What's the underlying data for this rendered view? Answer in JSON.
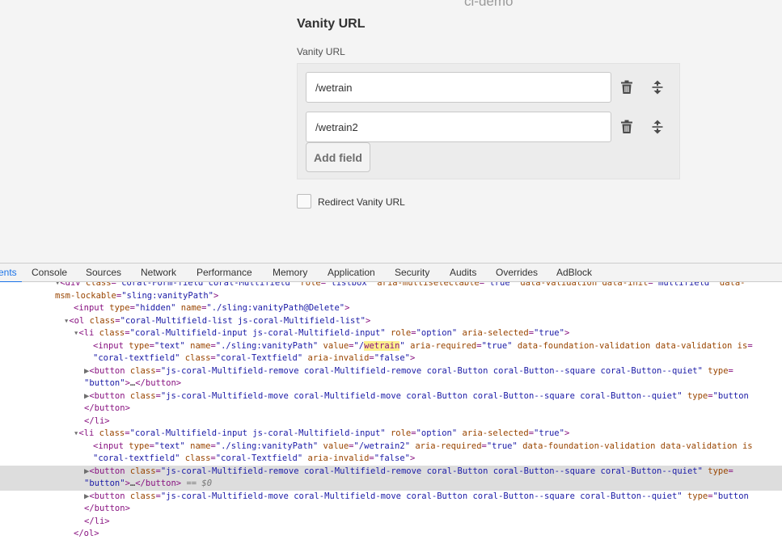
{
  "app": {
    "header_text": "ci-demo",
    "section_title": "Vanity URL",
    "field_label": "Vanity URL",
    "fields": [
      {
        "value": "/wetrain"
      },
      {
        "value": "/wetrain2"
      }
    ],
    "add_field_label": "Add field",
    "redirect_label": "Redirect Vanity URL"
  },
  "devtools": {
    "tabs": [
      {
        "label": "ents",
        "active": true
      },
      {
        "label": "Console"
      },
      {
        "label": "Sources"
      },
      {
        "label": "Network"
      },
      {
        "label": "Performance"
      },
      {
        "label": "Memory"
      },
      {
        "label": "Application"
      },
      {
        "label": "Security"
      },
      {
        "label": "Audits"
      },
      {
        "label": "Overrides"
      },
      {
        "label": "AdBlock"
      }
    ],
    "lines": [
      {
        "indent": 68,
        "parts": [
          [
            "tri",
            "▾"
          ],
          [
            "tag",
            "<div "
          ],
          [
            "attr-name",
            "class"
          ],
          [
            "eq",
            "="
          ],
          [
            "attr-val",
            "\"coral-Form-field coral-Multifield\" "
          ],
          [
            "attr-name",
            "role"
          ],
          [
            "eq",
            "="
          ],
          [
            "attr-val",
            "\"listbox\" "
          ],
          [
            "attr-name",
            "aria-multiselectable"
          ],
          [
            "eq",
            "="
          ],
          [
            "attr-val",
            "\"true\" "
          ],
          [
            "attr-name",
            "data-validation data-init"
          ],
          [
            "eq",
            "="
          ],
          [
            "attr-val",
            "\"multifield\" "
          ],
          [
            "attr-name",
            "data-"
          ]
        ]
      },
      {
        "indent": 68,
        "parts": [
          [
            "attr-name",
            "msm-lockable"
          ],
          [
            "eq",
            "="
          ],
          [
            "attr-val",
            "\"sling:vanityPath\""
          ],
          [
            "tag",
            ">"
          ]
        ]
      },
      {
        "indent": 91,
        "parts": [
          [
            "tag",
            "<input "
          ],
          [
            "attr-name",
            "type"
          ],
          [
            "eq",
            "="
          ],
          [
            "attr-val",
            "\"hidden\" "
          ],
          [
            "attr-name",
            "name"
          ],
          [
            "eq",
            "="
          ],
          [
            "attr-val",
            "\"./sling:vanityPath@Delete\""
          ],
          [
            "tag",
            ">"
          ]
        ]
      },
      {
        "indent": 79,
        "parts": [
          [
            "tri",
            "▾"
          ],
          [
            "tag",
            "<ol "
          ],
          [
            "attr-name",
            "class"
          ],
          [
            "eq",
            "="
          ],
          [
            "attr-val",
            "\"coral-Multifield-list js-coral-Multifield-list\""
          ],
          [
            "tag",
            ">"
          ]
        ]
      },
      {
        "indent": 91,
        "parts": [
          [
            "tri",
            "▾"
          ],
          [
            "tag",
            "<li "
          ],
          [
            "attr-name",
            "class"
          ],
          [
            "eq",
            "="
          ],
          [
            "attr-val",
            "\"coral-Multifield-input js-coral-Multifield-input\" "
          ],
          [
            "attr-name",
            "role"
          ],
          [
            "eq",
            "="
          ],
          [
            "attr-val",
            "\"option\" "
          ],
          [
            "attr-name",
            "aria-selected"
          ],
          [
            "eq",
            "="
          ],
          [
            "attr-val",
            "\"true\""
          ],
          [
            "tag",
            ">"
          ]
        ]
      },
      {
        "indent": 115,
        "parts": [
          [
            "tag",
            "<input "
          ],
          [
            "attr-name",
            "type"
          ],
          [
            "eq",
            "="
          ],
          [
            "attr-val",
            "\"text\" "
          ],
          [
            "attr-name",
            "name"
          ],
          [
            "eq",
            "="
          ],
          [
            "attr-val",
            "\"./sling:vanityPath\" "
          ],
          [
            "attr-name",
            "value"
          ],
          [
            "eq",
            "="
          ],
          [
            "attr-val",
            "\"/"
          ],
          [
            "hl",
            "wetrain"
          ],
          [
            "attr-val",
            "\" "
          ],
          [
            "attr-name",
            "aria-required"
          ],
          [
            "eq",
            "="
          ],
          [
            "attr-val",
            "\"true\" "
          ],
          [
            "attr-name",
            "data-foundation-validation data-validation is"
          ],
          [
            "eq",
            "="
          ]
        ]
      },
      {
        "indent": 115,
        "parts": [
          [
            "attr-val",
            "\"coral-textfield\" "
          ],
          [
            "attr-name",
            "class"
          ],
          [
            "eq",
            "="
          ],
          [
            "attr-val",
            "\"coral-Textfield\" "
          ],
          [
            "attr-name",
            "aria-invalid"
          ],
          [
            "eq",
            "="
          ],
          [
            "attr-val",
            "\"false\""
          ],
          [
            "tag",
            ">"
          ]
        ]
      },
      {
        "indent": 104,
        "parts": [
          [
            "tri",
            "▶"
          ],
          [
            "tag",
            "<button "
          ],
          [
            "attr-name",
            "class"
          ],
          [
            "eq",
            "="
          ],
          [
            "attr-val",
            "\"js-coral-Multifield-remove coral-Multifield-remove coral-Button coral-Button--square coral-Button--quiet\" "
          ],
          [
            "attr-name",
            "type"
          ],
          [
            "eq",
            "="
          ]
        ]
      },
      {
        "indent": 104,
        "parts": [
          [
            "attr-val",
            "\"button\""
          ],
          [
            "tag",
            ">"
          ],
          [
            "plain",
            "…"
          ],
          [
            "tag",
            "</button>"
          ]
        ]
      },
      {
        "indent": 104,
        "parts": [
          [
            "tri",
            "▶"
          ],
          [
            "tag",
            "<button "
          ],
          [
            "attr-name",
            "class"
          ],
          [
            "eq",
            "="
          ],
          [
            "attr-val",
            "\"js-coral-Multifield-move coral-Multifield-move coral-Button coral-Button--square coral-Button--quiet\" "
          ],
          [
            "attr-name",
            "type"
          ],
          [
            "eq",
            "="
          ],
          [
            "attr-val",
            "\"button"
          ]
        ]
      },
      {
        "indent": 104,
        "parts": [
          [
            "tag",
            "</button>"
          ]
        ]
      },
      {
        "indent": 104,
        "parts": [
          [
            "tag",
            "</li>"
          ]
        ]
      },
      {
        "indent": 91,
        "parts": [
          [
            "tri",
            "▾"
          ],
          [
            "tag",
            "<li "
          ],
          [
            "attr-name",
            "class"
          ],
          [
            "eq",
            "="
          ],
          [
            "attr-val",
            "\"coral-Multifield-input js-coral-Multifield-input\" "
          ],
          [
            "attr-name",
            "role"
          ],
          [
            "eq",
            "="
          ],
          [
            "attr-val",
            "\"option\" "
          ],
          [
            "attr-name",
            "aria-selected"
          ],
          [
            "eq",
            "="
          ],
          [
            "attr-val",
            "\"true\""
          ],
          [
            "tag",
            ">"
          ]
        ]
      },
      {
        "indent": 115,
        "parts": [
          [
            "tag",
            "<input "
          ],
          [
            "attr-name",
            "type"
          ],
          [
            "eq",
            "="
          ],
          [
            "attr-val",
            "\"text\" "
          ],
          [
            "attr-name",
            "name"
          ],
          [
            "eq",
            "="
          ],
          [
            "attr-val",
            "\"./sling:vanityPath\" "
          ],
          [
            "attr-name",
            "value"
          ],
          [
            "eq",
            "="
          ],
          [
            "attr-val",
            "\"/wetrain2\" "
          ],
          [
            "attr-name",
            "aria-required"
          ],
          [
            "eq",
            "="
          ],
          [
            "attr-val",
            "\"true\" "
          ],
          [
            "attr-name",
            "data-foundation-validation data-validation is"
          ]
        ]
      },
      {
        "indent": 115,
        "parts": [
          [
            "attr-val",
            "\"coral-textfield\" "
          ],
          [
            "attr-name",
            "class"
          ],
          [
            "eq",
            "="
          ],
          [
            "attr-val",
            "\"coral-Textfield\" "
          ],
          [
            "attr-name",
            "aria-invalid"
          ],
          [
            "eq",
            "="
          ],
          [
            "attr-val",
            "\"false\""
          ],
          [
            "tag",
            ">"
          ]
        ]
      },
      {
        "indent": 104,
        "selected": true,
        "parts": [
          [
            "tri",
            "▶"
          ],
          [
            "tag",
            "<button "
          ],
          [
            "attr-name",
            "class"
          ],
          [
            "eq",
            "="
          ],
          [
            "attr-val",
            "\"js-coral-Multifield-remove coral-Multifield-remove coral-Button coral-Button--square coral-Button--quiet\" "
          ],
          [
            "attr-name",
            "type"
          ],
          [
            "eq",
            "="
          ]
        ]
      },
      {
        "indent": 104,
        "selected": true,
        "parts": [
          [
            "attr-val",
            "\"button\""
          ],
          [
            "tag",
            ">"
          ],
          [
            "plain",
            "…"
          ],
          [
            "tag",
            "</button>"
          ],
          [
            "dollar",
            " == $0"
          ]
        ]
      },
      {
        "indent": 104,
        "parts": [
          [
            "tri",
            "▶"
          ],
          [
            "tag",
            "<button "
          ],
          [
            "attr-name",
            "class"
          ],
          [
            "eq",
            "="
          ],
          [
            "attr-val",
            "\"js-coral-Multifield-move coral-Multifield-move coral-Button coral-Button--square coral-Button--quiet\" "
          ],
          [
            "attr-name",
            "type"
          ],
          [
            "eq",
            "="
          ],
          [
            "attr-val",
            "\"button"
          ]
        ]
      },
      {
        "indent": 104,
        "parts": [
          [
            "tag",
            "</button>"
          ]
        ]
      },
      {
        "indent": 104,
        "parts": [
          [
            "tag",
            "</li>"
          ]
        ]
      },
      {
        "indent": 91,
        "parts": [
          [
            "tag",
            "</ol>"
          ]
        ]
      }
    ]
  }
}
